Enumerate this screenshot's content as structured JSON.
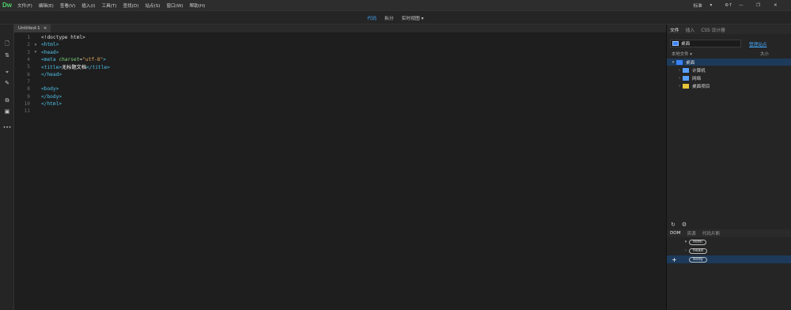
{
  "app": {
    "logo": "Dw"
  },
  "menu": [
    "文件(F)",
    "编辑(E)",
    "查看(V)",
    "插入(I)",
    "工具(T)",
    "查找(D)",
    "站点(S)",
    "窗口(W)",
    "帮助(H)"
  ],
  "menu_right": {
    "workspace": "标准",
    "workspace_arrow": "▾",
    "sync": "⚙↑"
  },
  "window_controls": [
    "—",
    "❐",
    "✕"
  ],
  "view_modes": {
    "code": "代码",
    "split": "拆分",
    "live": "实时视图",
    "live_arrow": "▾"
  },
  "document_tab": {
    "name": "Untitled-1",
    "close": "×"
  },
  "editor": {
    "lines": [
      {
        "n": "1",
        "fold": "",
        "html": "<span class=\"plain\">&lt;!doctype html&gt;</span>"
      },
      {
        "n": "2",
        "fold": "▼",
        "html": "<span class=\"tag\">&lt;html&gt;</span>"
      },
      {
        "n": "3",
        "fold": "▼",
        "html": "<span class=\"tag\">&lt;head&gt;</span>"
      },
      {
        "n": "4",
        "fold": "",
        "html": "<span class=\"tag\">&lt;meta </span><span class=\"attr\">charset</span><span class=\"plain\">=</span><span class=\"val\">\"utf-8\"</span><span class=\"tag\">&gt;</span>"
      },
      {
        "n": "5",
        "fold": "",
        "html": "<span class=\"tag\">&lt;title&gt;</span><span class=\"txt\">无标题文档</span><span class=\"tag\">&lt;/title&gt;</span>"
      },
      {
        "n": "6",
        "fold": "",
        "html": "<span class=\"tag\">&lt;/head&gt;</span>"
      },
      {
        "n": "7",
        "fold": "",
        "html": ""
      },
      {
        "n": "8",
        "fold": "",
        "html": "<span class=\"tag\">&lt;body&gt;</span>"
      },
      {
        "n": "9",
        "fold": "",
        "html": "<span class=\"tag\">&lt;/body&gt;</span>"
      },
      {
        "n": "10",
        "fold": "",
        "html": "<span class=\"tag\">&lt;/html&gt;</span>"
      },
      {
        "n": "11",
        "fold": "",
        "html": ""
      }
    ]
  },
  "files_panel": {
    "tabs": [
      "文件",
      "插入",
      "CSS 设计器"
    ],
    "site_select": "桌面",
    "manage_sites": "管理站点",
    "col_local": "本地文件 ▾",
    "col_size": "大小",
    "tree": [
      {
        "label": "桌面",
        "chev": "▾",
        "icon": "desktop-icon",
        "color": "#3b82f6",
        "indent": 4,
        "selected": true
      },
      {
        "label": "计算机",
        "chev": "›",
        "icon": "computer-icon",
        "color": "#5aa0ff",
        "indent": 12,
        "selected": false
      },
      {
        "label": "网络",
        "chev": "›",
        "icon": "network-icon",
        "color": "#5aa0ff",
        "indent": 12,
        "selected": false
      },
      {
        "label": "桌面项目",
        "chev": "›",
        "icon": "folder-icon",
        "color": "#e8c33a",
        "indent": 12,
        "selected": false
      }
    ]
  },
  "dom_panel": {
    "tabs": [
      "DOM",
      "资源",
      "代码片断"
    ],
    "refresh": "↻",
    "gear": "⚙",
    "rows": [
      {
        "tag": "html",
        "prefix": "▾",
        "indent": 20,
        "selected": false
      },
      {
        "tag": "head",
        "prefix": "›",
        "indent": 20,
        "selected": false
      },
      {
        "tag": "body",
        "prefix": "",
        "indent": 28,
        "selected": true
      }
    ],
    "add": "+"
  },
  "left_tools": [
    "🗋",
    "⇅",
    "⌖",
    "✎",
    "⧉",
    "▣",
    "•••"
  ]
}
